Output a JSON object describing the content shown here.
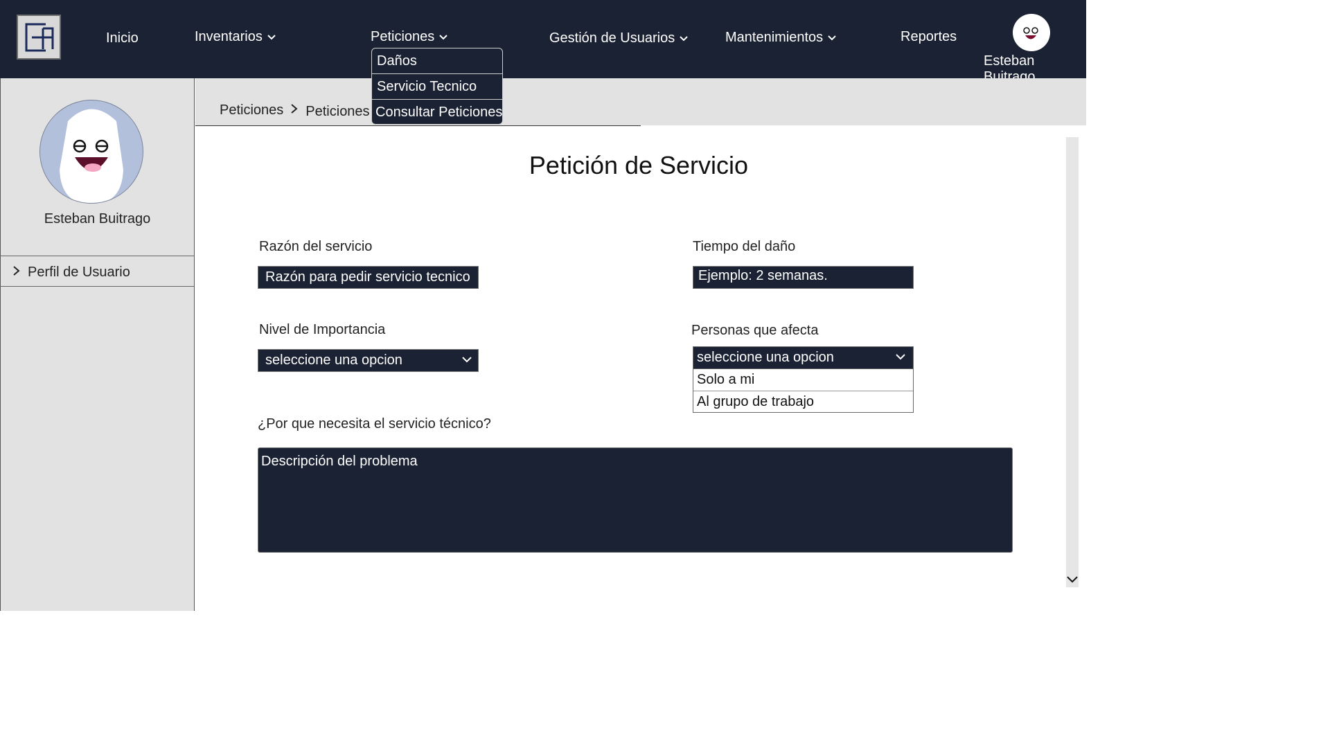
{
  "nav": {
    "inicio": "Inicio",
    "inventarios": "Inventarios",
    "peticiones": "Peticiones",
    "gestion": "Gestión de Usuarios",
    "mantenimientos": "Mantenimientos",
    "reportes": "Reportes",
    "user_name": "Esteban Buitrago"
  },
  "dropdown": {
    "items": [
      "Daños",
      "Servicio Tecnico",
      "Consultar Peticiones"
    ]
  },
  "sidebar": {
    "user_name": "Esteban Buitrago",
    "link": "Perfil de Usuario"
  },
  "breadcrumb": {
    "root": "Peticiones",
    "current": "Peticiones de"
  },
  "form": {
    "title": "Petición de Servicio",
    "razon_label": "Razón del servicio",
    "razon_placeholder": "Razón para pedir servicio tecnico",
    "tiempo_label": "Tiempo del daño",
    "tiempo_placeholder": "Ejemplo: 2 semanas.",
    "nivel_label": "Nivel de Importancia",
    "nivel_value": "seleccione una opcion",
    "personas_label": "Personas que afecta",
    "personas_value": "seleccione una opcion",
    "personas_options": [
      "Solo a mi",
      "Al grupo de trabajo"
    ],
    "porque_label": "¿Por que necesita el servicio técnico?",
    "descripcion_placeholder": "Descripción del problema"
  },
  "colors": {
    "nav_bg": "#1b2233",
    "sidebar_bg": "#e2e2e2",
    "avatar_bg": "#b3c0db"
  }
}
